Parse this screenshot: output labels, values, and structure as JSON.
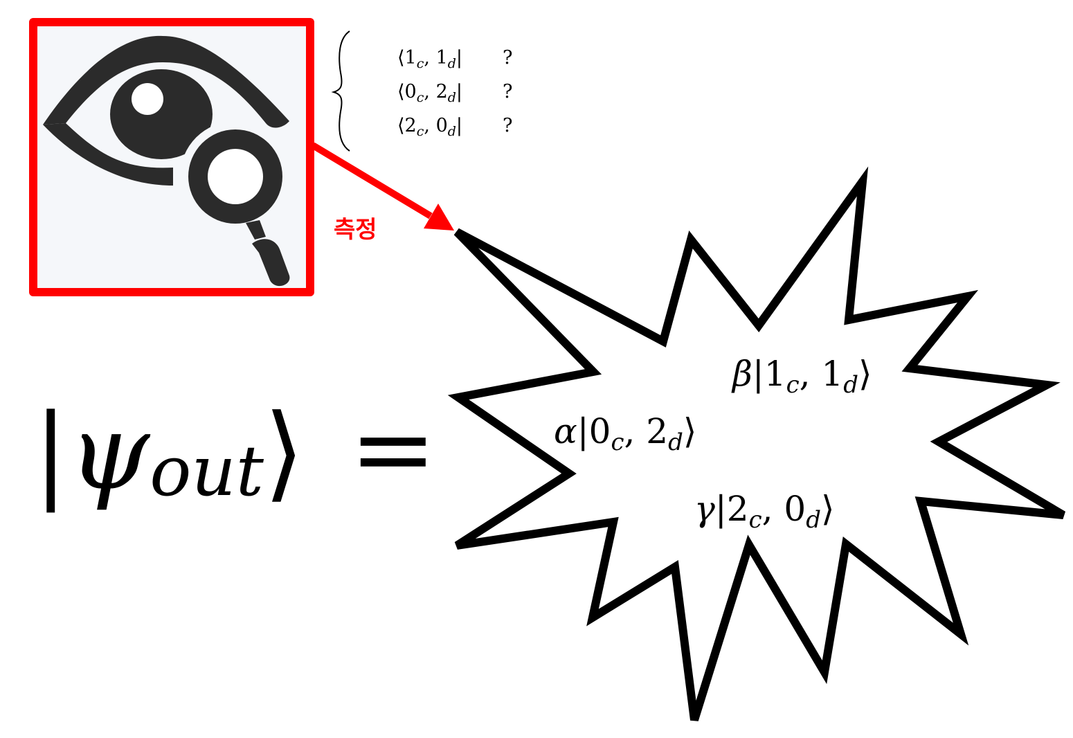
{
  "colors": {
    "frame": "#ff0000",
    "arrow": "#ff0000",
    "icon": "#2b2b2b",
    "icon_bg": "#f5f7fa",
    "burst_stroke": "#000000",
    "burst_fill": "#ffffff",
    "text": "#000000"
  },
  "measure_icon": {
    "icon_name": "eye-magnifier-icon"
  },
  "measure_label": "측정",
  "bra_list": [
    {
      "bra": {
        "open": "⟨",
        "a": "1",
        "a_sub": "c",
        "sep": ", ",
        "b": "1",
        "b_sub": "d",
        "close": "|"
      },
      "value": "?"
    },
    {
      "bra": {
        "open": "⟨",
        "a": "0",
        "a_sub": "c",
        "sep": ", ",
        "b": "2",
        "b_sub": "d",
        "close": "|"
      },
      "value": "?"
    },
    {
      "bra": {
        "open": "⟨",
        "a": "2",
        "a_sub": "c",
        "sep": ", ",
        "b": "0",
        "b_sub": "d",
        "close": "|"
      },
      "value": "?"
    }
  ],
  "psi_equation": {
    "open": "|",
    "psi": "ψ",
    "sub": "out",
    "close": "⟩",
    "equals": "="
  },
  "burst_terms": [
    {
      "coef": "β",
      "open": "|",
      "a": "1",
      "a_sub": "c",
      "sep": ", ",
      "b": "1",
      "b_sub": "d",
      "close": "⟩"
    },
    {
      "coef": "α",
      "open": "|",
      "a": "0",
      "a_sub": "c",
      "sep": ", ",
      "b": "2",
      "b_sub": "d",
      "close": "⟩"
    },
    {
      "coef": "γ",
      "open": "|",
      "a": "2",
      "a_sub": "c",
      "sep": ", ",
      "b": "0",
      "b_sub": "d",
      "close": "⟩"
    }
  ]
}
